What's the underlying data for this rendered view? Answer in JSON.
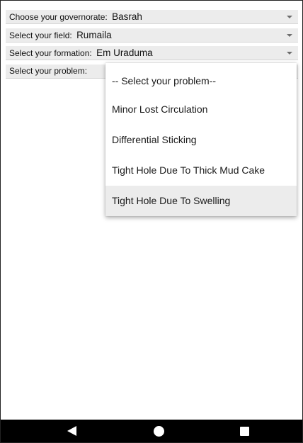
{
  "governorate": {
    "label": "Choose your governorate:",
    "value": "Basrah"
  },
  "field": {
    "label": "Select your field:",
    "value": "Rumaila"
  },
  "formation": {
    "label": "Select your formation:",
    "value": "Em Uraduma"
  },
  "problem": {
    "label": "Select your problem:"
  },
  "problem_menu": {
    "options": [
      "-- Select your problem--",
      "Minor Lost Circulation",
      "Differential Sticking",
      "Tight Hole Due To Thick Mud Cake",
      "Tight Hole Due To Swelling"
    ],
    "highlighted_index": 4
  },
  "colors": {
    "spinner_bg": "#ececec",
    "highlight": "#ececec",
    "navbar": "#000000"
  },
  "navbar": {
    "icons": [
      "back-icon",
      "home-icon",
      "recents-icon"
    ]
  }
}
